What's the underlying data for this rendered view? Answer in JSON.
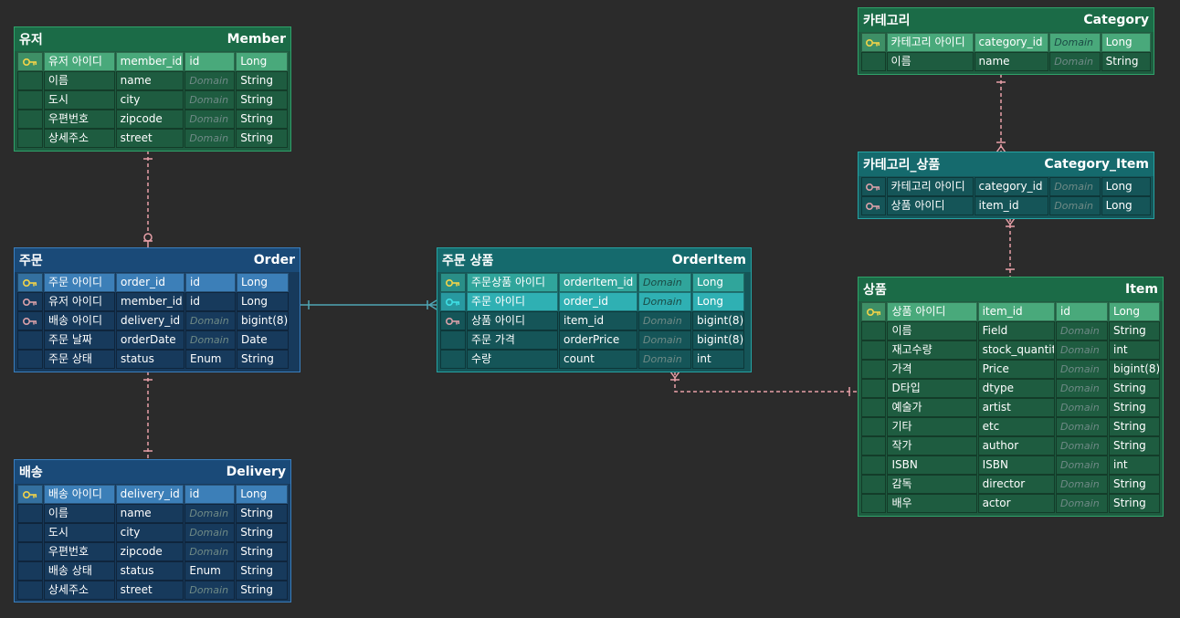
{
  "colors": {
    "background": "#2b2b2b",
    "relation_line": "#e8a0a8",
    "identifying_line": "#4fa6b4",
    "pk_key": "#f2d349",
    "fk_key": "#d9a0a8",
    "pkfk_key": "#3fe0e6"
  },
  "domain_placeholder": "Domain",
  "entities": {
    "member": {
      "logical_name": "유저",
      "physical_name": "Member",
      "columns": [
        {
          "key": "pk",
          "logical": "유저 아이디",
          "physical": "member_id",
          "domain": "id",
          "type": "Long"
        },
        {
          "key": "",
          "logical": "이름",
          "physical": "name",
          "domain": "",
          "type": "String"
        },
        {
          "key": "",
          "logical": "도시",
          "physical": "city",
          "domain": "",
          "type": "String"
        },
        {
          "key": "",
          "logical": "우편번호",
          "physical": "zipcode",
          "domain": "",
          "type": "String"
        },
        {
          "key": "",
          "logical": "상세주소",
          "physical": "street",
          "domain": "",
          "type": "String"
        }
      ]
    },
    "order": {
      "logical_name": "주문",
      "physical_name": "Order",
      "columns": [
        {
          "key": "pk",
          "logical": "주문 아이디",
          "physical": "order_id",
          "domain": "id",
          "type": "Long"
        },
        {
          "key": "fk",
          "logical": "유저 아이디",
          "physical": "member_id",
          "domain": "id",
          "type": "Long"
        },
        {
          "key": "fk",
          "logical": "배송 아이디",
          "physical": "delivery_id",
          "domain": "",
          "type": "bigint(8)"
        },
        {
          "key": "",
          "logical": "주문 날짜",
          "physical": "orderDate",
          "domain": "",
          "type": "Date"
        },
        {
          "key": "",
          "logical": "주문 상태",
          "physical": "status",
          "domain": "Enum",
          "type": "String"
        }
      ]
    },
    "delivery": {
      "logical_name": "배송",
      "physical_name": "Delivery",
      "columns": [
        {
          "key": "pk",
          "logical": "배송 아이디",
          "physical": "delivery_id",
          "domain": "id",
          "type": "Long"
        },
        {
          "key": "",
          "logical": "이름",
          "physical": "name",
          "domain": "",
          "type": "String"
        },
        {
          "key": "",
          "logical": "도시",
          "physical": "city",
          "domain": "",
          "type": "String"
        },
        {
          "key": "",
          "logical": "우편번호",
          "physical": "zipcode",
          "domain": "",
          "type": "String"
        },
        {
          "key": "",
          "logical": "배송 상태",
          "physical": "status",
          "domain": "Enum",
          "type": "String"
        },
        {
          "key": "",
          "logical": "상세주소",
          "physical": "street",
          "domain": "",
          "type": "String"
        }
      ]
    },
    "order_item": {
      "logical_name": "주문 상품",
      "physical_name": "OrderItem",
      "columns": [
        {
          "key": "pk",
          "logical": "주문상품 아이디",
          "physical": "orderItem_id",
          "domain": "",
          "type": "Long"
        },
        {
          "key": "pkfk",
          "logical": "주문 아이디",
          "physical": "order_id",
          "domain": "",
          "type": "Long"
        },
        {
          "key": "fk",
          "logical": "상품 아이디",
          "physical": "item_id",
          "domain": "",
          "type": "bigint(8)"
        },
        {
          "key": "",
          "logical": "주문 가격",
          "physical": "orderPrice",
          "domain": "",
          "type": "bigint(8)"
        },
        {
          "key": "",
          "logical": "수량",
          "physical": "count",
          "domain": "",
          "type": "int"
        }
      ]
    },
    "category": {
      "logical_name": "카테고리",
      "physical_name": "Category",
      "columns": [
        {
          "key": "pk",
          "logical": "카테고리 아이디",
          "physical": "category_id",
          "domain": "",
          "type": "Long"
        },
        {
          "key": "",
          "logical": "이름",
          "physical": "name",
          "domain": "",
          "type": "String"
        }
      ]
    },
    "category_item": {
      "logical_name": "카테고리_상품",
      "physical_name": "Category_Item",
      "columns": [
        {
          "key": "fk",
          "logical": "카테고리 아이디",
          "physical": "category_id",
          "domain": "",
          "type": "Long"
        },
        {
          "key": "fk",
          "logical": "상품 아이디",
          "physical": "item_id",
          "domain": "",
          "type": "Long"
        }
      ]
    },
    "item": {
      "logical_name": "상품",
      "physical_name": "Item",
      "columns": [
        {
          "key": "pk",
          "logical": "상품 아이디",
          "physical": "item_id",
          "domain": "id",
          "type": "Long"
        },
        {
          "key": "",
          "logical": "이름",
          "physical": "Field",
          "domain": "",
          "type": "String"
        },
        {
          "key": "",
          "logical": "재고수량",
          "physical": "stock_quantity",
          "domain": "",
          "type": "int"
        },
        {
          "key": "",
          "logical": "가격",
          "physical": "Price",
          "domain": "",
          "type": "bigint(8)"
        },
        {
          "key": "",
          "logical": "D타입",
          "physical": "dtype",
          "domain": "",
          "type": "String"
        },
        {
          "key": "",
          "logical": "예술가",
          "physical": "artist",
          "domain": "",
          "type": "String"
        },
        {
          "key": "",
          "logical": "기타",
          "physical": "etc",
          "domain": "",
          "type": "String"
        },
        {
          "key": "",
          "logical": "작가",
          "physical": "author",
          "domain": "",
          "type": "String"
        },
        {
          "key": "",
          "logical": "ISBN",
          "physical": "ISBN",
          "domain": "",
          "type": "int"
        },
        {
          "key": "",
          "logical": "감독",
          "physical": "director",
          "domain": "",
          "type": "String"
        },
        {
          "key": "",
          "logical": "배우",
          "physical": "actor",
          "domain": "",
          "type": "String"
        }
      ]
    }
  }
}
